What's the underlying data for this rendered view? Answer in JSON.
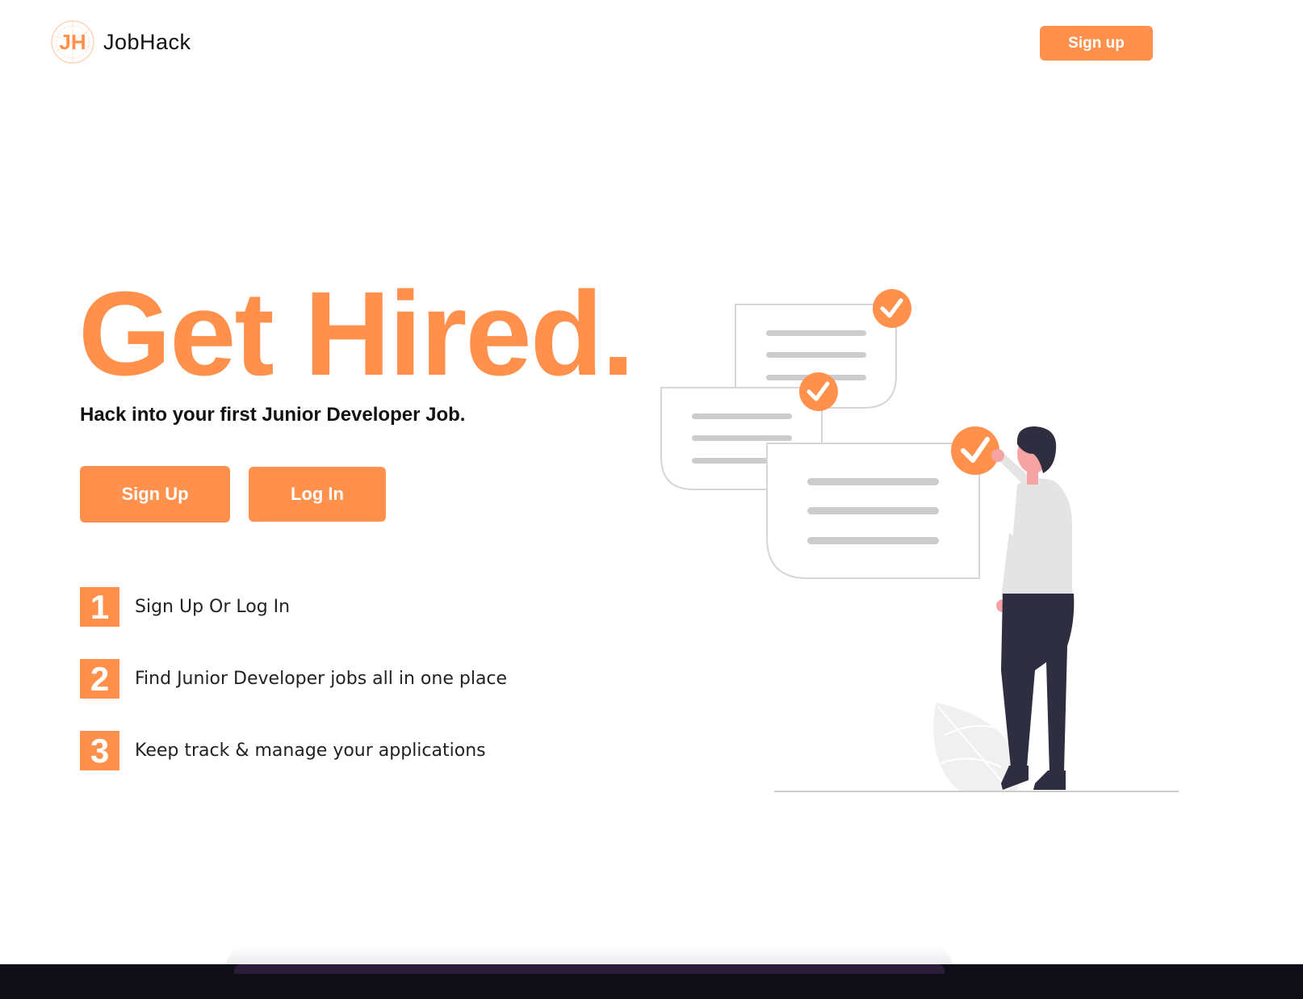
{
  "brand": {
    "logo_initials": "JH",
    "name": "JobHack",
    "accent_color": "#ff914d"
  },
  "nav": {
    "signup_label": "Sign up"
  },
  "hero": {
    "title": "Get Hired.",
    "subtitle": "Hack into your first Junior Developer Job.",
    "signup_label": "Sign Up",
    "login_label": "Log In"
  },
  "steps": [
    {
      "number": "1",
      "text": "Sign Up Or Log In"
    },
    {
      "number": "2",
      "text": "Find Junior Developer jobs all in one place"
    },
    {
      "number": "3",
      "text": "Keep track & manage your applications"
    }
  ],
  "illustration": {
    "icon": "person-checking-documents-illustration",
    "check_icon": "checkmark-icon"
  }
}
